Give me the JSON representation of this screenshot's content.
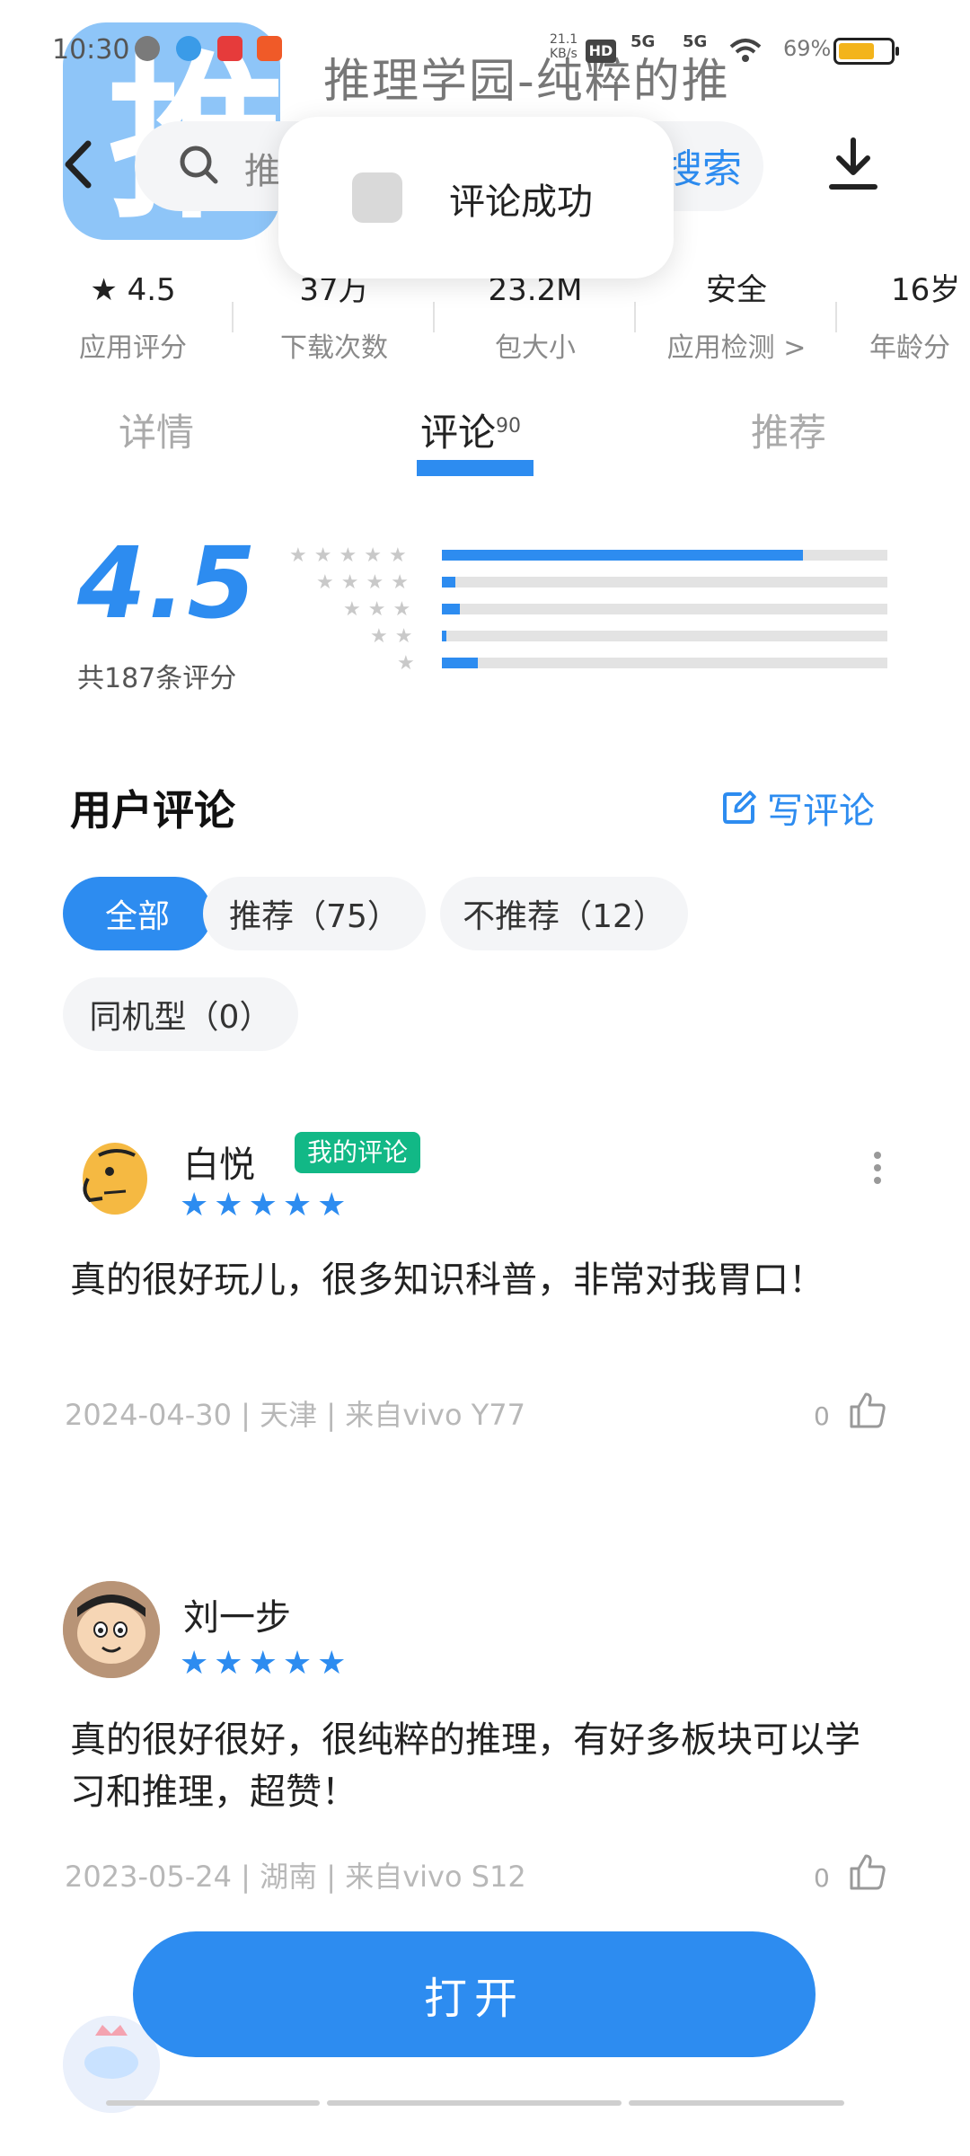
{
  "status_bar": {
    "time": "10:30",
    "net_speed": "21.1\nKB/s",
    "hd": "HD",
    "signal1": "5G",
    "signal2": "5G",
    "battery_pct": "69%",
    "battery_level": 0.69
  },
  "header": {
    "app_icon_glyph": "推",
    "app_title": "推理学园-纯粹的推",
    "search_placeholder": "推",
    "search_button": "搜索"
  },
  "toast": {
    "text": "评论成功"
  },
  "stats": [
    {
      "value": "★ 4.5",
      "label": "应用评分"
    },
    {
      "value": "37万",
      "label": "下载次数"
    },
    {
      "value": "23.2M",
      "label": "包大小"
    },
    {
      "value": "安全",
      "label": "应用检测 >"
    },
    {
      "value": "16岁",
      "label": "年龄分"
    }
  ],
  "tabs": {
    "details": "详情",
    "comments": "评论",
    "comments_count": "90",
    "recommend": "推荐"
  },
  "rating": {
    "score": "4.5",
    "count_label": "共187条评分",
    "distribution": [
      0.81,
      0.03,
      0.04,
      0.01,
      0.08
    ]
  },
  "reviews_section": {
    "title": "用户评论",
    "write_label": "写评论"
  },
  "filters": [
    {
      "label": "全部",
      "active": true
    },
    {
      "label": "推荐（75）",
      "active": false
    },
    {
      "label": "不推荐（12）",
      "active": false
    },
    {
      "label": "同机型（0）",
      "active": false
    }
  ],
  "reviews": [
    {
      "name": "白悦",
      "badge": "我的评论",
      "rating": 5,
      "text": "真的很好玩儿，很多知识科普，非常对我胃口！",
      "meta": "2024-04-30 | 天津 | 来自vivo Y77",
      "likes": "0"
    },
    {
      "name": "刘一步",
      "rating": 5,
      "text": "真的很好很好，很纯粹的推理，有好多板块可以学习和推理，超赞！",
      "meta": "2023-05-24 | 湖南 | 来自vivo S12",
      "likes": "0"
    }
  ],
  "open_button": "打开",
  "colors": {
    "accent": "#2d8cf0",
    "badge": "#12b886",
    "battery": "#f3b41b"
  }
}
